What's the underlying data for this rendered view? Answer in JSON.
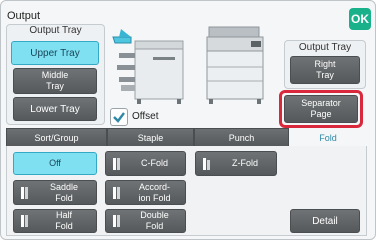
{
  "screen": {
    "title": "Output",
    "ok_label": "OK"
  },
  "output_tray_left": {
    "label": "Output Tray",
    "buttons": [
      {
        "label": "Upper Tray",
        "selected": true
      },
      {
        "label": "Middle\nTray",
        "selected": false
      },
      {
        "label": "Lower Tray",
        "selected": false
      }
    ]
  },
  "output_tray_right": {
    "label": "Output Tray",
    "button": "Right\nTray"
  },
  "separator_page": {
    "label": "Separator\nPage"
  },
  "offset": {
    "label": "Offset",
    "checked": true
  },
  "tabs": {
    "sort_group": "Sort/Group",
    "staple": "Staple",
    "punch": "Punch",
    "fold": "Fold"
  },
  "fold_options": {
    "off": "Off",
    "c_fold": "C-Fold",
    "z_fold": "Z-Fold",
    "saddle_fold": "Saddle\nFold",
    "accordion_fold": "Accord-\nion Fold",
    "half_fold": "Half\nFold",
    "double_fold": "Double\nFold"
  },
  "detail_label": "Detail",
  "colors": {
    "selected": "#7fe0f1",
    "button": "#5f6365",
    "ok": "#18b18a",
    "highlight": "#d9283c",
    "tab_active_text": "#2f89a6"
  }
}
